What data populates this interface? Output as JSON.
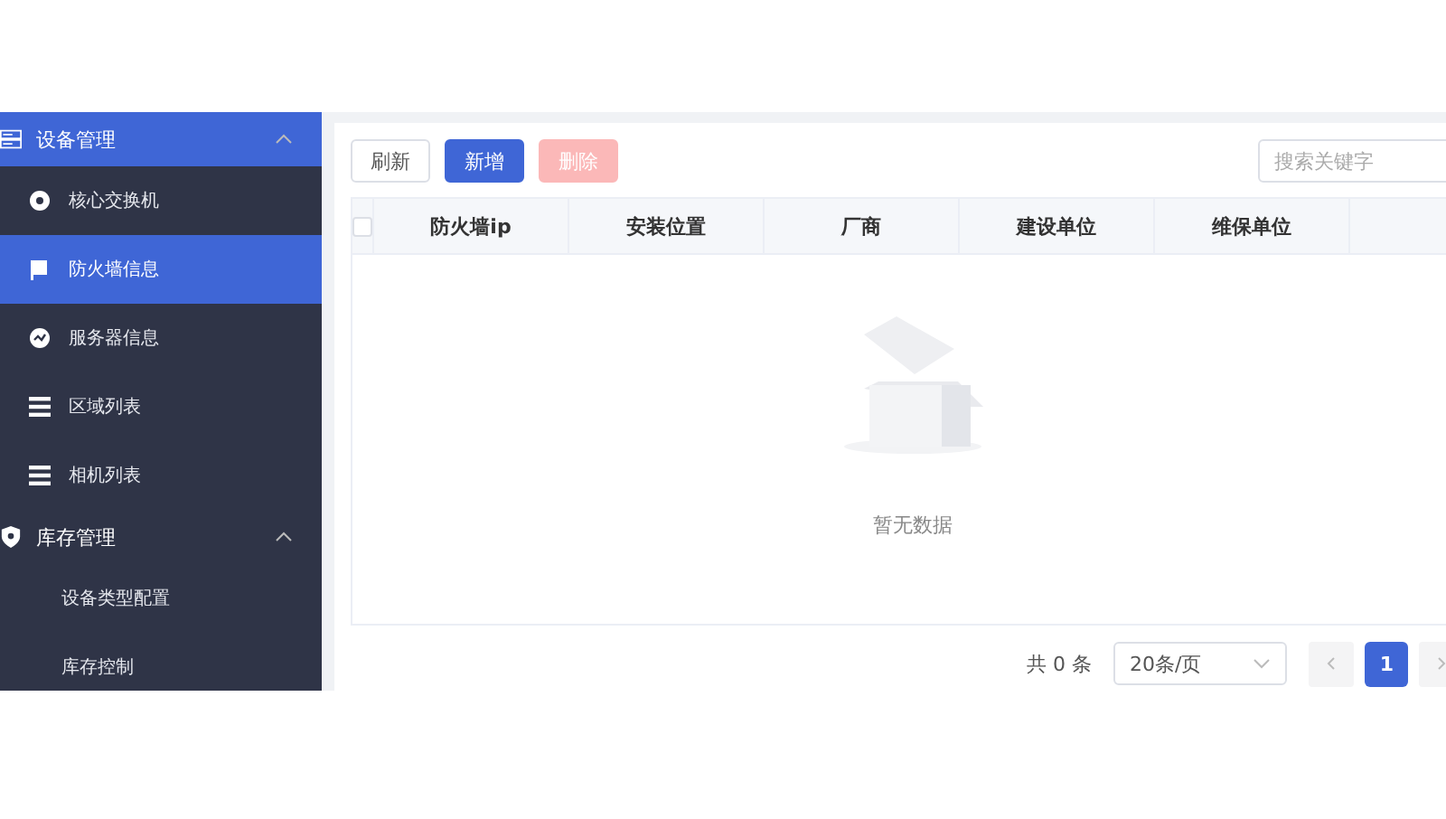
{
  "sidebar": {
    "groups": [
      {
        "label": "设备管理",
        "kind": "device",
        "expanded": true,
        "highlighted": true,
        "items": [
          {
            "label": "核心交换机",
            "kind": "dot",
            "selected": false
          },
          {
            "label": "防火墙信息",
            "kind": "flag",
            "selected": true
          },
          {
            "label": "服务器信息",
            "kind": "gauge",
            "selected": false
          },
          {
            "label": "区域列表",
            "kind": "list",
            "selected": false
          },
          {
            "label": "相机列表",
            "kind": "list",
            "selected": false
          }
        ]
      },
      {
        "label": "库存管理",
        "kind": "shield",
        "expanded": true,
        "highlighted": false,
        "items": [
          {
            "label": "设备类型配置",
            "kind": "plain",
            "selected": false
          },
          {
            "label": "库存控制",
            "kind": "plain",
            "selected": false
          }
        ]
      }
    ]
  },
  "toolbar": {
    "buttons": [
      {
        "label": "刷新",
        "kind": "default",
        "disabled": false
      },
      {
        "label": "新增",
        "kind": "primary",
        "disabled": false
      },
      {
        "label": "删除",
        "kind": "danger",
        "disabled": true
      }
    ],
    "search": {
      "placeholder": "搜索关键字"
    }
  },
  "table": {
    "select_all": {
      "checked": false
    },
    "columns": [
      "防火墙ip",
      "安装位置",
      "厂商",
      "建设单位",
      "维保单位"
    ],
    "empty_text": "暂无数据"
  },
  "pagination": {
    "total": "共 0 条",
    "page_size": "20条/页",
    "pages": [
      {
        "label": "1",
        "selected": true
      }
    ]
  }
}
